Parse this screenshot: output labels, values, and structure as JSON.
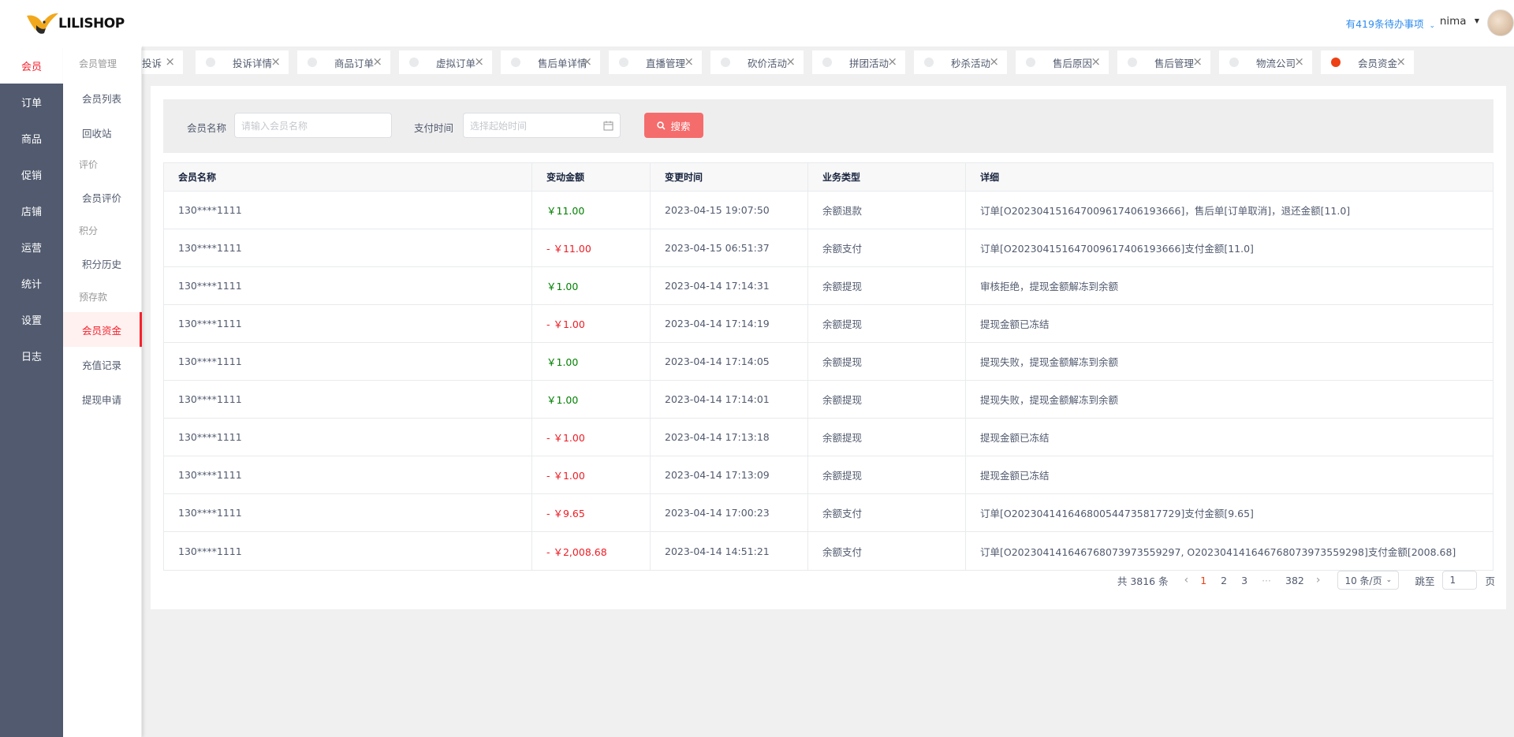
{
  "app": {
    "logo_text": "LILISHOP"
  },
  "nav": {
    "items": [
      "会员",
      "订单",
      "商品",
      "促销",
      "店铺",
      "运营",
      "统计",
      "设置",
      "日志"
    ],
    "active": "会员"
  },
  "submenu": {
    "groups": [
      {
        "title": "会员管理",
        "items": [
          "会员列表",
          "回收站"
        ]
      },
      {
        "title": "评价",
        "items": [
          "会员评价"
        ]
      },
      {
        "title": "积分",
        "items": [
          "积分历史"
        ]
      },
      {
        "title": "预存款",
        "items": [
          "会员资金",
          "充值记录",
          "提现申请"
        ]
      }
    ],
    "active": "会员资金"
  },
  "header": {
    "todo": "有419条待办事项",
    "username": "nima"
  },
  "tabs": [
    {
      "label": "投诉",
      "active": false
    },
    {
      "label": "投诉详情",
      "active": false
    },
    {
      "label": "商品订单",
      "active": false
    },
    {
      "label": "虚拟订单",
      "active": false
    },
    {
      "label": "售后单详情",
      "active": false
    },
    {
      "label": "直播管理",
      "active": false
    },
    {
      "label": "砍价活动",
      "active": false
    },
    {
      "label": "拼团活动",
      "active": false
    },
    {
      "label": "秒杀活动",
      "active": false
    },
    {
      "label": "售后原因",
      "active": false
    },
    {
      "label": "售后管理",
      "active": false
    },
    {
      "label": "物流公司",
      "active": false
    },
    {
      "label": "会员资金",
      "active": true
    }
  ],
  "search": {
    "member_label": "会员名称",
    "member_placeholder": "请输入会员名称",
    "time_label": "支付时间",
    "time_placeholder": "选择起始时间",
    "button": "搜索"
  },
  "table": {
    "columns": [
      "会员名称",
      "变动金额",
      "变更时间",
      "业务类型",
      "详细"
    ],
    "rows": [
      {
        "member": "130****1111",
        "amount": "￥11.00",
        "positive": true,
        "time": "2023-04-15 19:07:50",
        "type": "余额退款",
        "detail": "订单[O202304151647009617406193666]，售后单[订单取消]，退还金额[11.0]"
      },
      {
        "member": "130****1111",
        "amount": "- ￥11.00",
        "positive": false,
        "time": "2023-04-15 06:51:37",
        "type": "余额支付",
        "detail": "订单[O202304151647009617406193666]支付金额[11.0]"
      },
      {
        "member": "130****1111",
        "amount": "￥1.00",
        "positive": true,
        "time": "2023-04-14 17:14:31",
        "type": "余额提现",
        "detail": "审核拒绝，提现金额解冻到余额"
      },
      {
        "member": "130****1111",
        "amount": "- ￥1.00",
        "positive": false,
        "time": "2023-04-14 17:14:19",
        "type": "余额提现",
        "detail": "提现金额已冻结"
      },
      {
        "member": "130****1111",
        "amount": "￥1.00",
        "positive": true,
        "time": "2023-04-14 17:14:05",
        "type": "余额提现",
        "detail": "提现失败，提现金额解冻到余额"
      },
      {
        "member": "130****1111",
        "amount": "￥1.00",
        "positive": true,
        "time": "2023-04-14 17:14:01",
        "type": "余额提现",
        "detail": "提现失败，提现金额解冻到余额"
      },
      {
        "member": "130****1111",
        "amount": "- ￥1.00",
        "positive": false,
        "time": "2023-04-14 17:13:18",
        "type": "余额提现",
        "detail": "提现金额已冻结"
      },
      {
        "member": "130****1111",
        "amount": "- ￥1.00",
        "positive": false,
        "time": "2023-04-14 17:13:09",
        "type": "余额提现",
        "detail": "提现金额已冻结"
      },
      {
        "member": "130****1111",
        "amount": "- ￥9.65",
        "positive": false,
        "time": "2023-04-14 17:00:23",
        "type": "余额支付",
        "detail": "订单[O202304141646800544735817729]支付金额[9.65]"
      },
      {
        "member": "130****1111",
        "amount": "- ￥2,008.68",
        "positive": false,
        "time": "2023-04-14 14:51:21",
        "type": "余额支付",
        "detail": "订单[O202304141646768073973559297, O202304141646768073973559298]支付金额[2008.68]"
      }
    ]
  },
  "pagination": {
    "total": "共 3816 条",
    "pages": [
      "1",
      "2",
      "3"
    ],
    "ellipsis": "···",
    "last": "382",
    "current": "1",
    "page_size": "10 条/页",
    "jump_label": "跳至",
    "jump_value": "1",
    "page_suffix": "页"
  },
  "colors": {
    "accent": "#f5222d",
    "nav_bg": "#515a6e",
    "button": "#f56c6c",
    "positive": "#008000",
    "negative": "#ed1c24",
    "link": "#2d8cf0"
  }
}
